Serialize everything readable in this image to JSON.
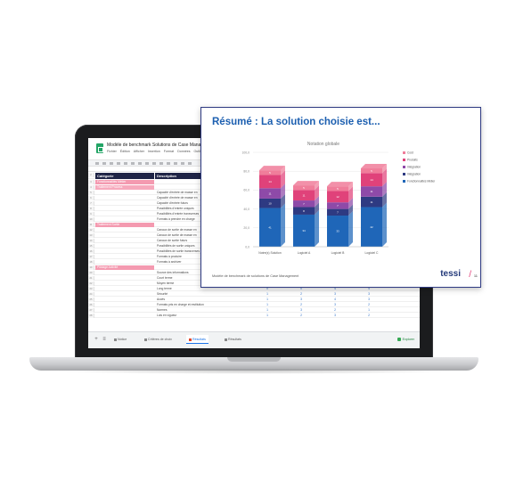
{
  "spreadsheet": {
    "title": "Modèle de benchmark Solutions de Case Management",
    "menu": [
      "Fichier",
      "Édition",
      "Afficher",
      "Insertion",
      "Format",
      "Données",
      "Outils"
    ],
    "columns": {
      "category": "Catégorie",
      "description": "Description"
    },
    "rows": [
      {
        "n": "3",
        "style": "pink",
        "category": "Fonctionnalités Métier",
        "description": "",
        "nums": [
          "",
          "",
          "",
          ""
        ]
      },
      {
        "n": "4",
        "style": "pinkb",
        "category": "Traitement Process",
        "description": "",
        "nums": [
          "",
          "",
          "",
          ""
        ]
      },
      {
        "n": "5",
        "style": "",
        "category": "",
        "description": "Capacité d'entrée de masse en",
        "nums": [
          "",
          "",
          "",
          ""
        ]
      },
      {
        "n": "6",
        "style": "",
        "category": "",
        "description": "Capacité d'entrée de masse en",
        "nums": [
          "",
          "",
          "",
          ""
        ]
      },
      {
        "n": "7",
        "style": "",
        "category": "",
        "description": "Capacité d'entrée futurs",
        "nums": [
          "",
          "",
          "",
          ""
        ]
      },
      {
        "n": "8",
        "style": "",
        "category": "",
        "description": "Possibilités d'entrée uniques",
        "nums": [
          "",
          "",
          "",
          ""
        ]
      },
      {
        "n": "9",
        "style": "",
        "category": "",
        "description": "Possibilités d'entrée transverses",
        "nums": [
          "",
          "",
          "",
          ""
        ]
      },
      {
        "n": "10",
        "style": "",
        "category": "",
        "description": "Formats à prendre en charge",
        "nums": [
          "",
          "",
          "",
          ""
        ]
      },
      {
        "n": "11",
        "style": "pink",
        "category": "Traitement Sortie",
        "description": "",
        "nums": [
          "",
          "",
          "",
          ""
        ]
      },
      {
        "n": "12",
        "style": "",
        "category": "",
        "description": "Canaux de sortie de masse en",
        "nums": [
          "",
          "",
          "",
          ""
        ]
      },
      {
        "n": "13",
        "style": "",
        "category": "",
        "description": "Canaux de sortie de masse en",
        "nums": [
          "",
          "",
          "",
          ""
        ]
      },
      {
        "n": "14",
        "style": "",
        "category": "",
        "description": "Canaux de sortie futurs",
        "nums": [
          "",
          "",
          "",
          ""
        ]
      },
      {
        "n": "15",
        "style": "",
        "category": "",
        "description": "Possibilités de sortie uniques",
        "nums": [
          "",
          "",
          "",
          ""
        ]
      },
      {
        "n": "16",
        "style": "",
        "category": "",
        "description": "Possibilités de sortie transverses",
        "nums": [
          "",
          "",
          "",
          ""
        ]
      },
      {
        "n": "17",
        "style": "",
        "category": "",
        "description": "Formats à produire",
        "nums": [
          "",
          "",
          "",
          ""
        ]
      },
      {
        "n": "18",
        "style": "",
        "category": "",
        "description": "Formats à archiver",
        "nums": [
          "",
          "",
          "",
          ""
        ]
      },
      {
        "n": "19",
        "style": "pink",
        "category": "Pilotage Activité",
        "description": "",
        "nums": [
          "",
          "",
          "",
          ""
        ]
      },
      {
        "n": "20",
        "style": "",
        "category": "",
        "description": "Source des informations",
        "nums": [
          "1",
          "3",
          "2",
          "4"
        ]
      },
      {
        "n": "21",
        "style": "",
        "category": "",
        "description": "Court terme",
        "nums": [
          "1",
          "3",
          "3",
          "4"
        ]
      },
      {
        "n": "22",
        "style": "",
        "category": "",
        "description": "Moyen terme",
        "nums": [
          "1",
          "3",
          "3",
          "1"
        ]
      },
      {
        "n": "23",
        "style": "",
        "category": "",
        "description": "Long terme",
        "nums": [
          "0",
          "0",
          "4",
          "4"
        ]
      },
      {
        "n": "24",
        "style": "",
        "category": "",
        "description": "Sécurité",
        "nums": [
          "1",
          "2",
          "3",
          "3"
        ]
      },
      {
        "n": "25",
        "style": "",
        "category": "",
        "description": "Accès",
        "nums": [
          "1",
          "3",
          "4",
          "3"
        ]
      },
      {
        "n": "26",
        "style": "",
        "category": "",
        "description": "Formats pris en charge et restitution",
        "nums": [
          "1",
          "2",
          "3",
          "2"
        ]
      },
      {
        "n": "27",
        "style": "",
        "category": "",
        "description": "Normes",
        "nums": [
          "1",
          "3",
          "2",
          "1"
        ]
      },
      {
        "n": "28",
        "style": "",
        "category": "",
        "description": "Lois en vigueur",
        "nums": [
          "1",
          "2",
          "3",
          "2"
        ]
      }
    ],
    "tabs": [
      {
        "label": "Notice",
        "active": false
      },
      {
        "label": "Critères de choix",
        "active": false
      },
      {
        "label": "Résultats",
        "active": true
      },
      {
        "label": "Résultats",
        "active": false
      }
    ],
    "explore": "Explorer"
  },
  "slide": {
    "title": "Résumé : La solution choisie est...",
    "footer": "Modèle de benchmark de solutions de Case Management",
    "logo": "tessi",
    "page_number": "11"
  },
  "chart_data": {
    "type": "bar",
    "stacked": true,
    "title": "Notation globale",
    "categories": [
      "Notre(s) Solution",
      "Logiciel A",
      "Logiciel B",
      "Logiciel C"
    ],
    "series": [
      {
        "name": "Fonctionnalités Métier",
        "color": "#1f66b8",
        "values": [
          41,
          34,
          33,
          42
        ]
      },
      {
        "name": "Intégration",
        "color": "#2e3a82",
        "values": [
          10,
          8,
          7,
          11
        ]
      },
      {
        "name": "Intégration",
        "color": "#8e4aa8",
        "values": [
          11,
          7,
          7,
          11
        ]
      },
      {
        "name": "Produits",
        "color": "#e0427a",
        "values": [
          14,
          11,
          12,
          14
        ]
      },
      {
        "name": "Coût",
        "color": "#f07d9a",
        "values": [
          5,
          5,
          5,
          5
        ]
      }
    ],
    "ylim": [
      0,
      100
    ],
    "yticks": [
      "0,0",
      "20,0",
      "40,0",
      "60,0",
      "80,0",
      "100,0"
    ],
    "legend_position": "right",
    "grid": true
  }
}
